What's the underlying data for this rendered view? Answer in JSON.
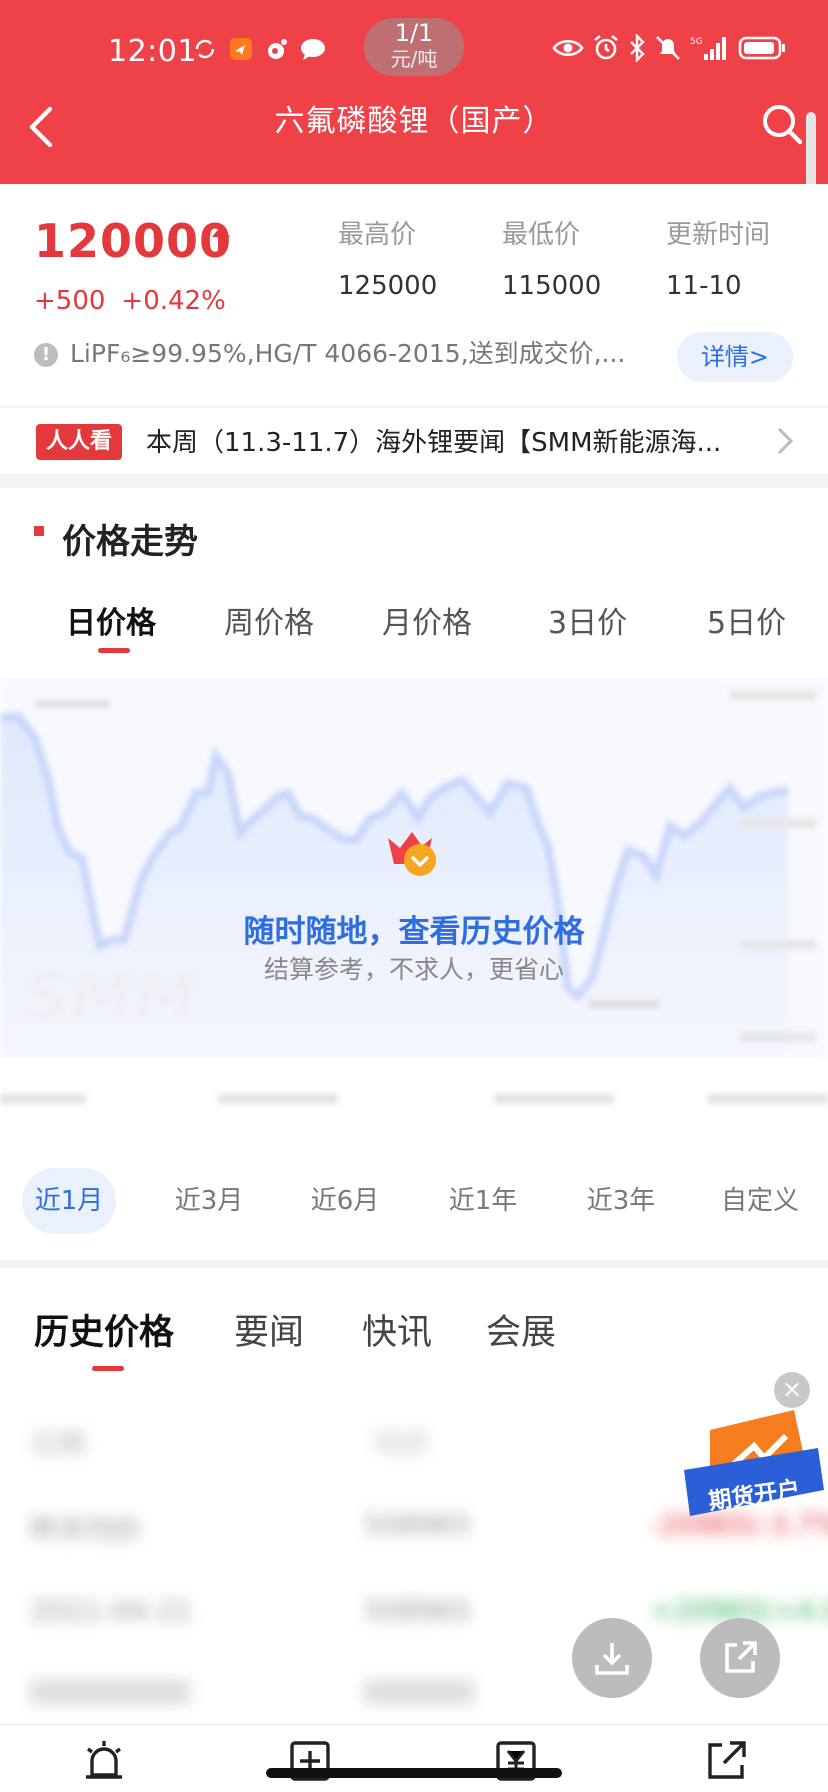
{
  "status_bar": {
    "time": "12:01"
  },
  "nav": {
    "title": "六氟磷酸锂（国产）",
    "page_indicator": "1/1",
    "unit": "元/吨"
  },
  "summary": {
    "price": "120000",
    "change_abs": "+500",
    "change_pct": "+0.42%",
    "stats": [
      {
        "label": "最高价",
        "value": "125000"
      },
      {
        "label": "最低价",
        "value": "115000"
      },
      {
        "label": "更新时间",
        "value": "11-10"
      }
    ],
    "spec": "LiPF₆≥99.95%,HG/T 4066-2015,送到成交价,...",
    "detail_label": "详情>"
  },
  "ticker": {
    "badge": "人人看",
    "text": "本周（11.3-11.7）海外锂要闻【SMM新能源海..."
  },
  "trend": {
    "title": "价格走势",
    "period_tabs": [
      "日价格",
      "周价格",
      "月价格",
      "3日价",
      "5日价"
    ],
    "overlay_title": "随时随地，查看历史价格",
    "overlay_subtitle": "结算参考，不求人，更省心",
    "range_tabs": [
      "近1月",
      "近3月",
      "近6月",
      "近1年",
      "近3年",
      "自定义"
    ]
  },
  "content_tabs": [
    "历史价格",
    "要闻",
    "快讯",
    "会展"
  ],
  "history_blurred": [
    [
      "日期",
      "均价",
      ""
    ],
    [
      "昨天均价",
      "508965",
      "-20965(-3.7%)"
    ],
    [
      "2021-04-21",
      "508965",
      "+20965(+4.0%)"
    ]
  ],
  "ad": {
    "label": "期货开户"
  },
  "colors": {
    "brand_red": "#ef4248",
    "accent_blue": "#2f6ee0",
    "price_red": "#e4393c"
  },
  "icons": {
    "back": "back-arrow-icon",
    "search": "search-icon",
    "download": "download-icon",
    "share": "share-icon"
  }
}
